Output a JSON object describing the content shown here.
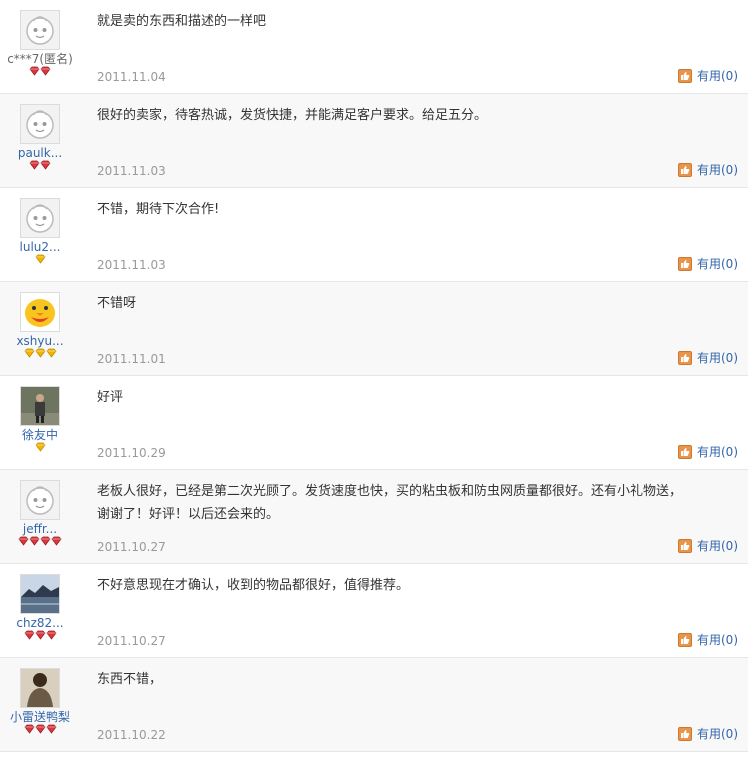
{
  "useful_label": "有用(0)",
  "colors": {
    "link": "#3366aa",
    "date": "#999999",
    "diamond_red": "#d9363e",
    "diamond_gold": "#f3b400"
  },
  "reviews": [
    {
      "username": "c***7(匿名)",
      "avatar": "default-face",
      "rank": {
        "type": "red-diamond",
        "count": 2
      },
      "content": "就是卖的东西和描述的一样吧",
      "date": "2011.11.04"
    },
    {
      "username": "paulk...",
      "avatar": "default-face",
      "rank": {
        "type": "red-diamond",
        "count": 2
      },
      "content": "很好的卖家，待客热诚，发货快捷，并能满足客户要求。给足五分。",
      "date": "2011.11.03"
    },
    {
      "username": "lulu2...",
      "avatar": "default-face",
      "rank": {
        "type": "gold-diamond",
        "count": 1
      },
      "content": "不错，期待下次合作!",
      "date": "2011.11.03"
    },
    {
      "username": "xshyu...",
      "avatar": "chick",
      "rank": {
        "type": "gold-diamond",
        "count": 3
      },
      "content": "不错呀",
      "date": "2011.11.01"
    },
    {
      "username": "徐友中",
      "avatar": "photo-person",
      "rank": {
        "type": "gold-diamond",
        "count": 1
      },
      "content": "好评",
      "date": "2011.10.29"
    },
    {
      "username": "jeffr...",
      "avatar": "default-face",
      "rank": {
        "type": "red-diamond",
        "count": 4
      },
      "content": "老板人很好，已经是第二次光顾了。发货速度也快，买的粘虫板和防虫网质量都很好。还有小礼物送，谢谢了！好评！以后还会来的。",
      "date": "2011.10.27"
    },
    {
      "username": "chz82...",
      "avatar": "photo-lake",
      "rank": {
        "type": "red-diamond",
        "count": 3
      },
      "content": "不好意思现在才确认，收到的物品都很好，值得推荐。",
      "date": "2011.10.27"
    },
    {
      "username": "小雷送鸭梨",
      "avatar": "photo-back",
      "rank": {
        "type": "red-diamond",
        "count": 3
      },
      "content": "东西不错，",
      "date": "2011.10.22"
    }
  ]
}
